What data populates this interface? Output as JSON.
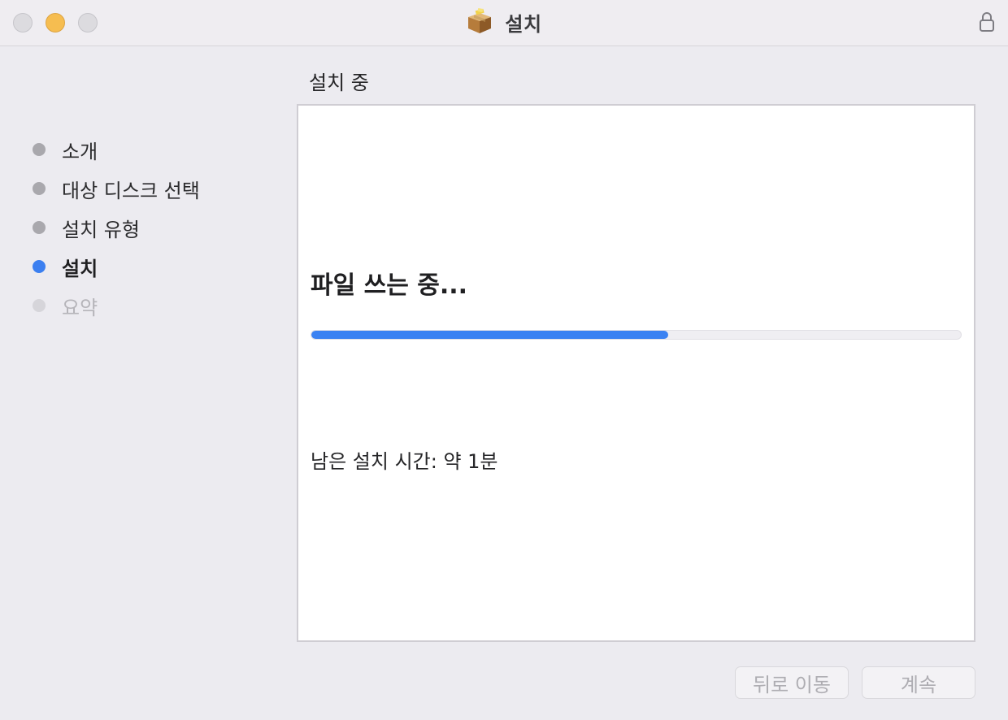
{
  "window": {
    "title": "설치",
    "app_icon": "package-icon",
    "lock_icon": "lock-icon",
    "traffic_lights": [
      "close",
      "minimize",
      "zoom"
    ]
  },
  "sidebar": {
    "steps": [
      {
        "label": "소개",
        "state": "completed"
      },
      {
        "label": "대상 디스크 선택",
        "state": "completed"
      },
      {
        "label": "설치 유형",
        "state": "completed"
      },
      {
        "label": "설치",
        "state": "current"
      },
      {
        "label": "요약",
        "state": "upcoming"
      }
    ]
  },
  "main": {
    "section_title": "설치 중",
    "status_heading": "파일 쓰는 중...",
    "progress_fraction": 0.55,
    "time_remaining": "남은 설치 시간: 약 1분"
  },
  "footer": {
    "back_label": "뒤로 이동",
    "continue_label": "계속"
  },
  "colors": {
    "accent": "#3b82f2",
    "minimize": "#f6bd50",
    "window_bg": "#ecebf0"
  }
}
